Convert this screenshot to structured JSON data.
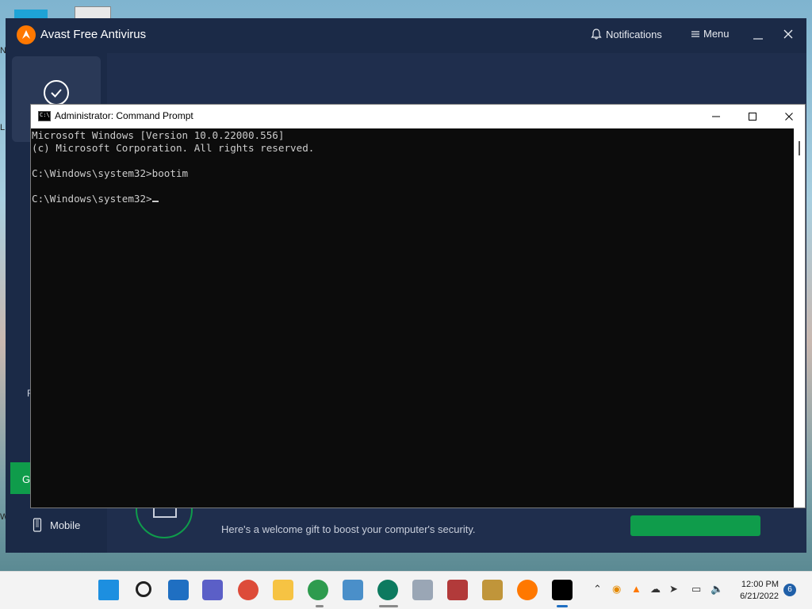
{
  "avast": {
    "title": "Avast Free Antivirus",
    "notifications_label": "Notifications",
    "menu_label": "Menu",
    "sidebar_letter": "F",
    "green_button_letter": "G",
    "mobile_label": "Mobile",
    "gift_text": "Here's a welcome gift to boost your computer's security.",
    "brand_color": "#ff7800",
    "accent_color": "#0f9c4b"
  },
  "cmd": {
    "title": "Administrator: Command Prompt",
    "icon_text": "C:\\",
    "lines": [
      "Microsoft Windows [Version 10.0.22000.556]",
      "(c) Microsoft Corporation. All rights reserved.",
      "",
      "C:\\Windows\\system32>bootim",
      "",
      "C:\\Windows\\system32>"
    ]
  },
  "desktop": {
    "edge_glyphs": [
      "N",
      "L",
      "W"
    ]
  },
  "taskbar": {
    "apps": [
      {
        "name": "start-button-icon",
        "color": "#1d8fe0"
      },
      {
        "name": "search-icon",
        "color": "#202020"
      },
      {
        "name": "task-view-icon",
        "color": "#1f6fc2"
      },
      {
        "name": "chat-icon",
        "color": "#5b5fc7"
      },
      {
        "name": "chrome-icon",
        "color": "#dd4b39"
      },
      {
        "name": "file-explorer-icon",
        "color": "#f6c343"
      },
      {
        "name": "chrome-beta-icon",
        "color": "#2e9b4e"
      },
      {
        "name": "photos-icon",
        "color": "#4a8fc9"
      },
      {
        "name": "app-u-icon",
        "color": "#0d7a5f"
      },
      {
        "name": "disc-tool-icon",
        "color": "#9aa6b5"
      },
      {
        "name": "security-app-icon",
        "color": "#b23a3a"
      },
      {
        "name": "unlock-tool-icon",
        "color": "#c0953a"
      },
      {
        "name": "avast-taskbar-icon",
        "color": "#ff7800"
      },
      {
        "name": "command-prompt-taskbar-icon",
        "color": "#000000"
      }
    ],
    "time": "12:00 PM",
    "date": "6/21/2022",
    "notification_count": "6"
  }
}
